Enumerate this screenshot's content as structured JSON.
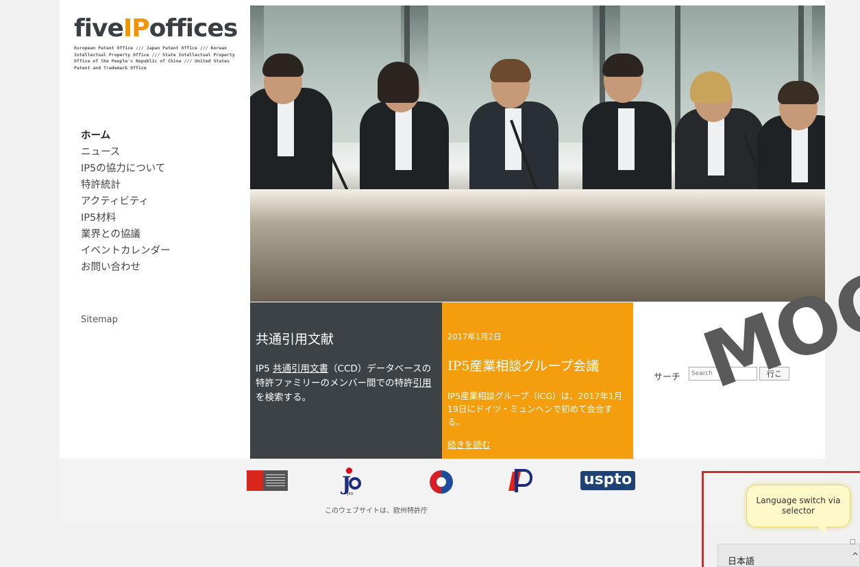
{
  "logo": {
    "word_part1": "five",
    "word_part2": "IP",
    "word_part3": "offices",
    "subtitle": "European Patent Office /// Japan Patent Office /// Korean Intellectual Property Office /// State Intellectual Property Office of the People's Republic of China /// United States Patent and Trademark Office"
  },
  "nav": {
    "items": [
      {
        "label": "ホーム",
        "active": true
      },
      {
        "label": "ニュース"
      },
      {
        "label": "IP5の協力について"
      },
      {
        "label": "特許統計"
      },
      {
        "label": "アクティビティ"
      },
      {
        "label": "IP5材料"
      },
      {
        "label": "業界との協議"
      },
      {
        "label": "イベントカレンダー"
      },
      {
        "label": "お問い合わせ"
      }
    ],
    "sitemap": "Sitemap"
  },
  "panel_ccd": {
    "title": "共通引用文献",
    "text_1": "IP5 ",
    "link_1": "共通引用文書",
    "text_2": "（CCD）データベースの特許ファミリーのメンバー間での特許",
    "link_2": "引用",
    "text_3": "を検索する。"
  },
  "panel_news": {
    "date": "2017年1月2日",
    "title": "IP5産業相談グループ会議",
    "text": "IP5産業相談グループ（ICG）は、2017年1月19日にドイツ・ミュンヘンで初めて会合する。",
    "more": "続きを読む"
  },
  "search": {
    "label": "サーチ",
    "placeholder": "Search",
    "button": "行こ"
  },
  "partners": {
    "uspto_text": "uspto",
    "jpo_text": "JPO",
    "credit": "このウェブサイトは、欧州特許庁"
  },
  "watermark": "MOC",
  "tooltip": "Language switch via selector",
  "language": {
    "selected": "日本語",
    "chevron": "^"
  },
  "colors": {
    "accent_orange": "#f49d0d",
    "dark_panel": "#3d4246",
    "highlight_red": "#c9302c",
    "uspto_blue": "#1d4275"
  }
}
